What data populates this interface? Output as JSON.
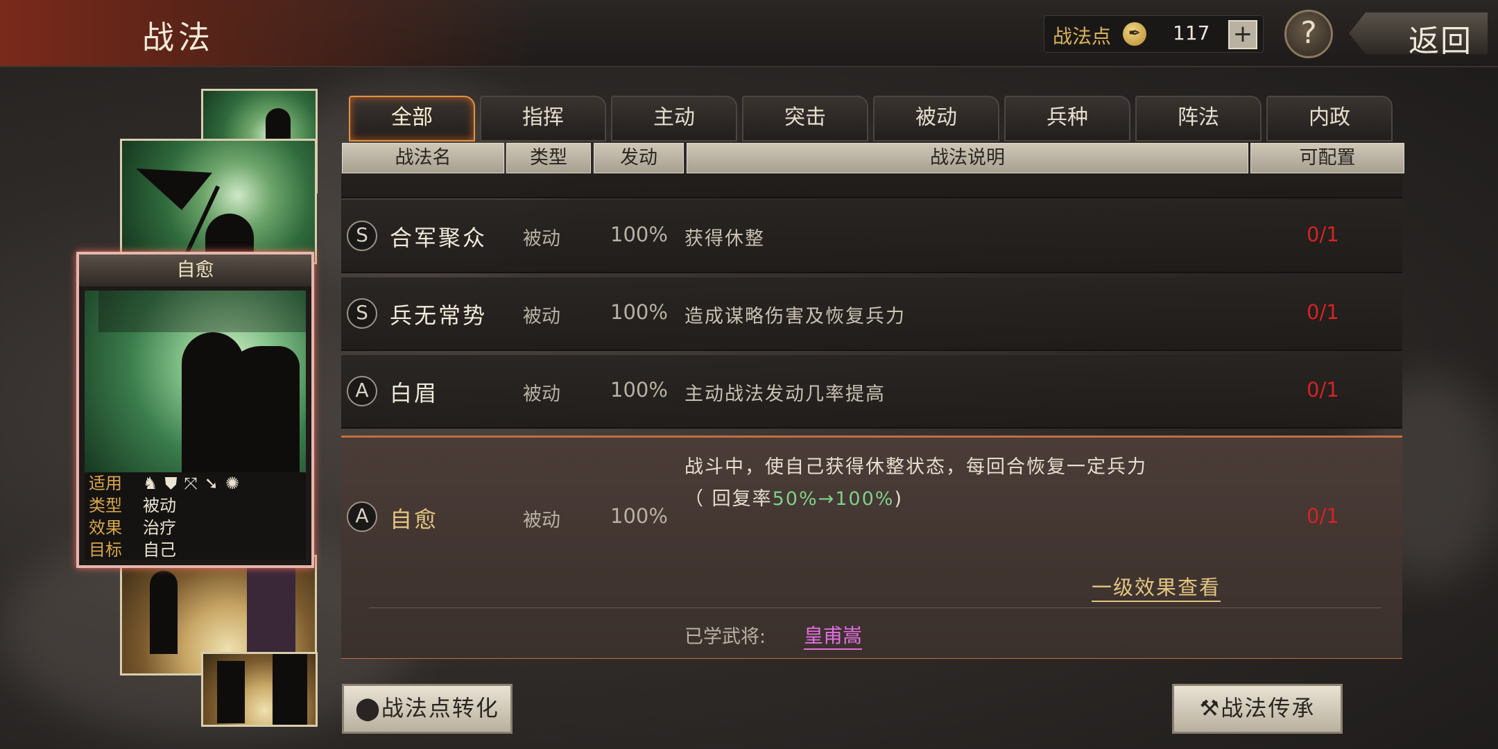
{
  "header": {
    "title": "战法",
    "points_label": "战法点",
    "points_value": "117",
    "plus": "+",
    "help": "?",
    "back": "返回"
  },
  "card": {
    "title": "自愈",
    "rows": [
      {
        "key": "适用",
        "value": ""
      },
      {
        "key": "类型",
        "value": "被动"
      },
      {
        "key": "效果",
        "value": "治疗"
      },
      {
        "key": "目标",
        "value": "自己"
      }
    ],
    "unit_icons": [
      "cavalry-icon",
      "shield-icon",
      "bow-icon",
      "spear-icon",
      "wheel-icon"
    ]
  },
  "tabs": [
    "全部",
    "指挥",
    "主动",
    "突击",
    "被动",
    "兵种",
    "阵法",
    "内政"
  ],
  "active_tab": "全部",
  "columns": [
    "战法名",
    "类型",
    "发动",
    "战法说明",
    "可配置"
  ],
  "rows": [
    {
      "grade": "S",
      "name": "合军聚众",
      "type": "被动",
      "rate": "100%",
      "desc": "获得休整",
      "config": "0/1"
    },
    {
      "grade": "S",
      "name": "兵无常势",
      "type": "被动",
      "rate": "100%",
      "desc": "造成谋略伤害及恢复兵力",
      "config": "0/1"
    },
    {
      "grade": "A",
      "name": "白眉",
      "type": "被动",
      "rate": "100%",
      "desc": "主动战法发动几率提高",
      "config": "0/1"
    }
  ],
  "selected": {
    "grade": "A",
    "name": "自愈",
    "type": "被动",
    "rate": "100%",
    "config": "0/1",
    "desc_line1": "战斗中，使自己获得休整状态，每回合恢复一定兵力",
    "desc_prefix": "（ 回复率",
    "desc_from": "50%",
    "desc_arrow": "→",
    "desc_to": "100%",
    "desc_suffix": ")",
    "detail_link": "一级效果查看",
    "learned_label": "已学武将:",
    "learned_general": "皇甫嵩"
  },
  "buttons": {
    "convert": "战法点转化",
    "inherit": "战法传承"
  },
  "colors": {
    "accent": "#e39443",
    "config_red": "#d42323",
    "highlight_green": "#7fd08a",
    "general_pink": "#e36fe0"
  }
}
